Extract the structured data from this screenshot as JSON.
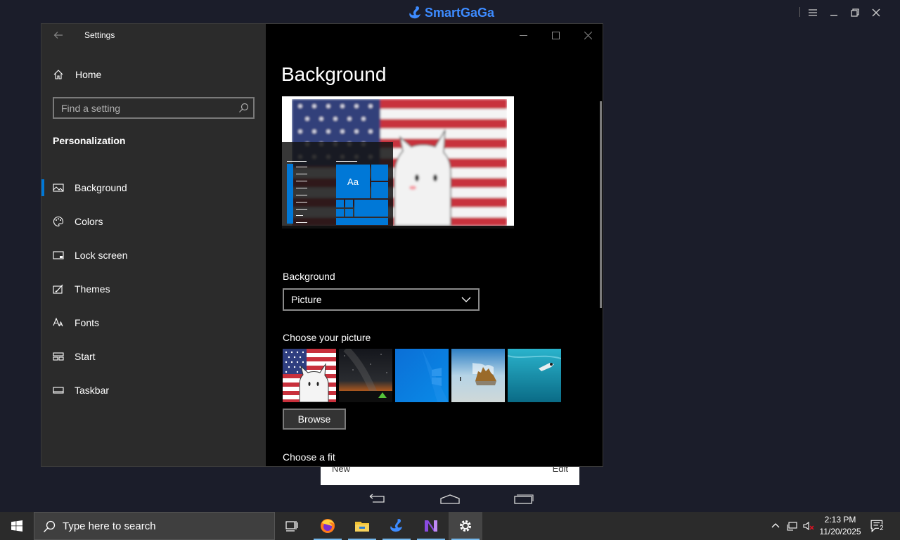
{
  "emulator": {
    "brand": "SmartGaGa",
    "controls": [
      "menu-icon",
      "minimize-icon",
      "restore-icon",
      "close-icon"
    ]
  },
  "android_popup": {
    "left_label": "New",
    "right_label": "Edit"
  },
  "settings": {
    "app_title": "Settings",
    "home_label": "Home",
    "search_placeholder": "Find a setting",
    "section_title": "Personalization",
    "nav": [
      {
        "label": "Background",
        "icon": "picture-icon",
        "active": true
      },
      {
        "label": "Colors",
        "icon": "palette-icon"
      },
      {
        "label": "Lock screen",
        "icon": "lock-screen-icon"
      },
      {
        "label": "Themes",
        "icon": "themes-brush-icon"
      },
      {
        "label": "Fonts",
        "icon": "font-icon"
      },
      {
        "label": "Start",
        "icon": "start-tiles-icon"
      },
      {
        "label": "Taskbar",
        "icon": "taskbar-icon"
      }
    ],
    "page_title": "Background",
    "preview_tile_label": "Aa",
    "background_label": "Background",
    "background_value": "Picture",
    "choose_picture_label": "Choose your picture",
    "pictures": [
      "flag-cat-picture",
      "night-sky-picture",
      "windows-logo-picture",
      "beach-rocks-picture",
      "underwater-swimmer-picture"
    ],
    "browse_label": "Browse",
    "choose_fit_label": "Choose a fit",
    "accent_color": "#0078d7"
  },
  "taskbar": {
    "search_placeholder": "Type here to search",
    "apps": [
      "task-view-icon",
      "firefox-icon",
      "file-explorer-icon",
      "smartgaga-icon",
      "visual-studio-icon",
      "settings-gear-icon"
    ],
    "time": "2:13 PM",
    "date": "11/20/2025",
    "notification_count": "2"
  }
}
